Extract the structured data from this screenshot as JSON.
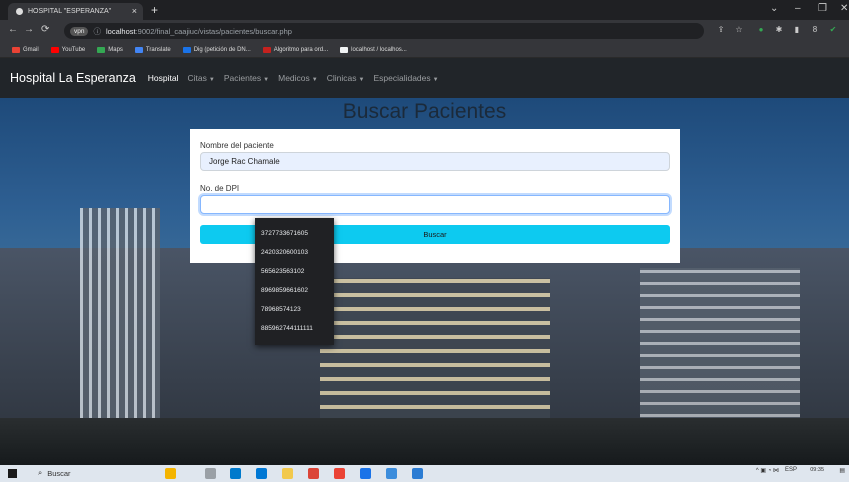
{
  "browser": {
    "tab_title": "HOSPITAL \"ESPERANZA\"",
    "omnibox": {
      "badge": "vpn",
      "host": "localhost",
      "path": ":9002/final_caajiuc/vistas/pacientes/buscar.php"
    },
    "bookmarks": [
      {
        "label": "Gmail",
        "color": "#ea4335"
      },
      {
        "label": "YouTube",
        "color": "#ff0000"
      },
      {
        "label": "Maps",
        "color": "#34a853"
      },
      {
        "label": "Translate",
        "color": "#4285f4"
      },
      {
        "label": "Dig (petición de DN...",
        "color": "#1a73e8"
      },
      {
        "label": "Algoritmo para ord...",
        "color": "#c5221f"
      },
      {
        "label": "localhost / localhos...",
        "color": "#f1f3f4"
      }
    ]
  },
  "navbar": {
    "brand": "Hospital La Esperanza",
    "links": [
      {
        "label": "Hospital",
        "dropdown": false,
        "active": true
      },
      {
        "label": "Citas",
        "dropdown": true,
        "active": false
      },
      {
        "label": "Pacientes",
        "dropdown": true,
        "active": false
      },
      {
        "label": "Medicos",
        "dropdown": true,
        "active": false
      },
      {
        "label": "Clinicas",
        "dropdown": true,
        "active": false
      },
      {
        "label": "Especialidades",
        "dropdown": true,
        "active": false
      }
    ]
  },
  "page": {
    "title": "Buscar Pacientes",
    "form": {
      "name_label": "Nombre del paciente",
      "name_value": "Jorge Rac Chamale",
      "dpi_label": "No. de DPI",
      "dpi_value": "",
      "submit_label": "Buscar"
    },
    "autocomplete": [
      "3727733671605",
      "2420320600103",
      "565623563102",
      "8969859661602",
      "78968574123",
      "885962744111111"
    ]
  },
  "taskbar": {
    "search_label": "Buscar",
    "lang": "ESP",
    "time": "09:35"
  },
  "colors": {
    "navbar_bg": "#212529",
    "button_info": "#0dcaf0",
    "autofill_bg": "#e8f0fe"
  }
}
